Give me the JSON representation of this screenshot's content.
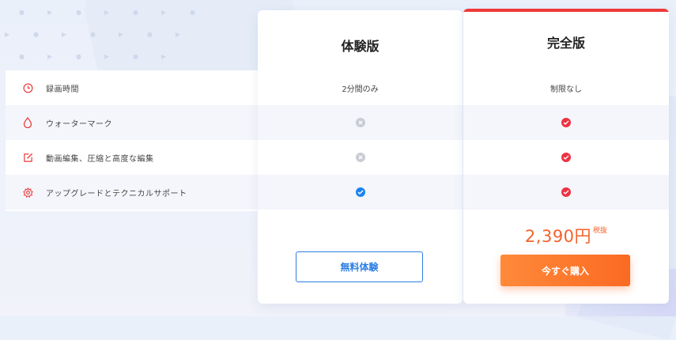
{
  "colors": {
    "accent_red": "#ee3a3a",
    "price_orange": "#f4622b",
    "trial_blue": "#2d7fe4",
    "check_blue": "#1a83f0",
    "check_red": "#ee3242",
    "cross_gray": "#c9ccd3"
  },
  "features": [
    {
      "label": "録画時間",
      "icon": "clock-icon"
    },
    {
      "label": "ウォーターマーク",
      "icon": "drop-icon"
    },
    {
      "label": "動画編集、圧縮と高度な編集",
      "icon": "edit-icon"
    },
    {
      "label": "アップグレードとテクニカルサポート",
      "icon": "gear-icon"
    }
  ],
  "plans": {
    "trial": {
      "title": "体験版",
      "recording_time": "2分間のみ",
      "marks": [
        "cross",
        "cross",
        "check"
      ],
      "button_label": "無料体験"
    },
    "full": {
      "title": "完全版",
      "recording_time": "制限なし",
      "marks": [
        "check",
        "check",
        "check"
      ],
      "price": "2,390円",
      "price_note": "税抜",
      "button_label": "今すぐ購入"
    }
  }
}
